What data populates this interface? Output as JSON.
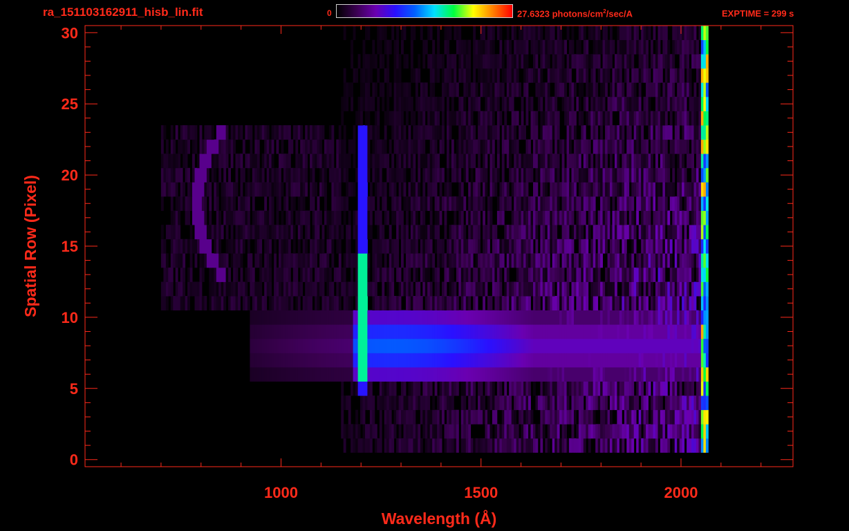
{
  "header": {
    "title": "ra_151103162911_hisb_lin.fit",
    "colorbar_min": "0",
    "colorbar_max_value": "27.6323",
    "colorbar_units_pre": " photons/cm",
    "colorbar_units_sup": "2",
    "colorbar_units_post": "/sec/A",
    "exptime": "EXPTIME = 299 s"
  },
  "colors": {
    "axis": "#ff2a1a",
    "background": "#000000",
    "colormap": [
      "#000000",
      "#3a0050",
      "#6a00b0",
      "#2a10ff",
      "#0060ff",
      "#00e0ff",
      "#00ff40",
      "#ffff00",
      "#ff8000",
      "#ff0000"
    ]
  },
  "chart_data": {
    "type": "heatmap",
    "title": "ra_151103162911_hisb_lin.fit",
    "xlabel": "Wavelength (Å)",
    "ylabel": "Spatial Row (Pixel)",
    "xlim": [
      510,
      2280
    ],
    "ylim": [
      -0.5,
      30.5
    ],
    "x_ticks": [
      1000,
      1500,
      2000
    ],
    "x_tick_labels": [
      "1000",
      "1500",
      "2000"
    ],
    "x_minor_step": 100,
    "y_ticks": [
      0,
      5,
      10,
      15,
      20,
      25,
      30
    ],
    "y_tick_labels": [
      "0",
      "5",
      "10",
      "15",
      "20",
      "25",
      "30"
    ],
    "y_minor_step": 1,
    "colorbar_range": [
      0,
      27.6323
    ],
    "colorbar_units": "photons/cm2/sec/A",
    "features": [
      {
        "type": "band",
        "rows": [
          6,
          10
        ],
        "wavelength_range": [
          920,
          2060
        ],
        "intensity": 12
      },
      {
        "type": "line",
        "wavelength": 1205,
        "rows": [
          5,
          23
        ],
        "intensity": 17
      },
      {
        "type": "arc",
        "wavelength_range": [
          790,
          860
        ],
        "rows": [
          13,
          23
        ],
        "intensity": 5
      },
      {
        "type": "edge",
        "wavelength": 2060,
        "rows": [
          1,
          30
        ],
        "intensity": 20
      }
    ]
  }
}
